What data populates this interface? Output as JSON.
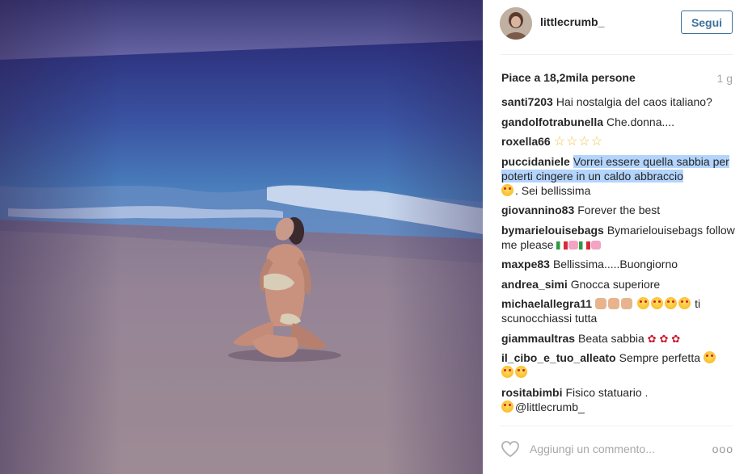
{
  "post": {
    "username": "littlecrumb_",
    "follow_label": "Segui",
    "likes_text": "Piace a 18,2mila persone",
    "age": "1 g",
    "add_comment_placeholder": "Aggiungi un commento...",
    "more_label": "ooo"
  },
  "comments": [
    {
      "user": "santi7203",
      "text": "Hai nostalgia del caos italiano?"
    },
    {
      "user": "gandolfotrabunella",
      "text": "Che.donna...."
    },
    {
      "user": "roxella66",
      "text": "",
      "emoji": "☆☆☆☆"
    },
    {
      "user": "puccidaniele",
      "text_highlighted": "Vorrei essere quella sabbia per poterti cingere in un caldo abbraccio",
      "text_after": ". Sei bellissima"
    },
    {
      "user": "giovannino83",
      "text": "Forever the best"
    },
    {
      "user": "bymarielouisebags",
      "text": "Bymarielouisebags follow me please"
    },
    {
      "user": "maxpe83",
      "text": "Bellissima.....Buongiorno"
    },
    {
      "user": "andrea_simi",
      "text": "Gnocca superiore"
    },
    {
      "user": "michaelallegra11",
      "text": "ti scunocchiassi tutta"
    },
    {
      "user": "giammaultras",
      "text": "Beata sabbia"
    },
    {
      "user": "il_cibo_e_tuo_alleato",
      "text": "Sempre perfetta"
    },
    {
      "user": "rositabimbi",
      "text": "Fisico statuario .",
      "mention": "@littlecrumb_"
    }
  ],
  "icons": {
    "heart": "heart-outline-icon",
    "more": "more-options-icon"
  },
  "colors": {
    "link_blue": "#3f729b",
    "highlight": "#b3d4fc",
    "muted": "#a5a7aa"
  }
}
